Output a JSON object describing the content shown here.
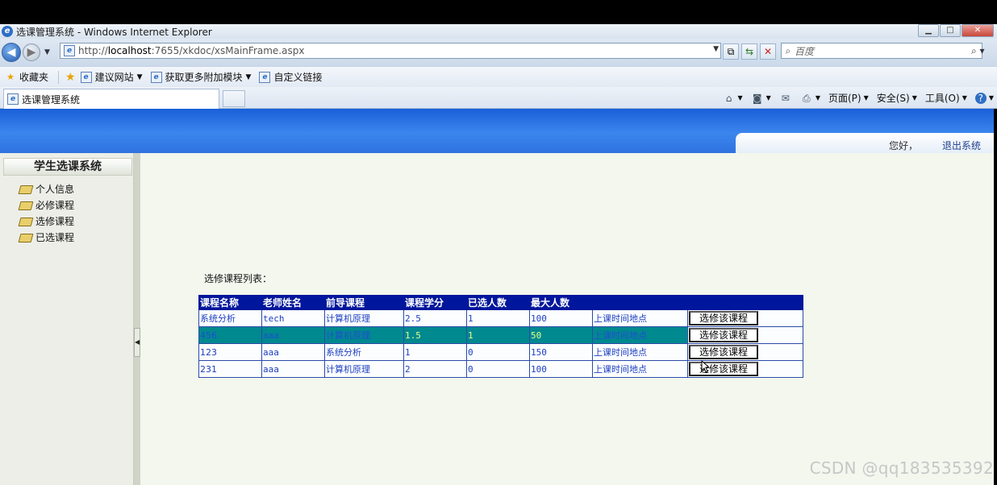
{
  "window": {
    "title": "选课管理系统 - Windows Internet Explorer",
    "minimize": "▁",
    "maximize": "□",
    "close": "✕"
  },
  "addressbar": {
    "url_prefix": "http://",
    "url_host": "localhost",
    "url_rest": ":7655/xkdoc/xsMainFrame.aspx",
    "search_placeholder": "百度"
  },
  "favorites": {
    "label": "收藏夹",
    "items": [
      "建议网站",
      "获取更多附加模块",
      "自定义链接"
    ]
  },
  "tab": {
    "title": "选课管理系统"
  },
  "commandbar": {
    "page": "页面(P)",
    "safety": "安全(S)",
    "tools": "工具(O)"
  },
  "header": {
    "greeting": "您好，",
    "logout": "退出系统"
  },
  "sidebar": {
    "title": "学生选课系统",
    "items": [
      "个人信息",
      "必修课程",
      "选修课程",
      "已选课程"
    ]
  },
  "content": {
    "list_title": "选修课程列表：",
    "columns": [
      "课程名称",
      "老师姓名",
      "前导课程",
      "课程学分",
      "已选人数",
      "最大人数",
      "",
      ""
    ],
    "rows": [
      {
        "name": "系统分析",
        "teacher": "tech",
        "prereq": "计算机原理",
        "credit": "2.5",
        "selected": "1",
        "max": "100",
        "time_link": "上课时间地点",
        "button": "选修该课程"
      },
      {
        "name": "456",
        "teacher": "aaa",
        "prereq": "计算机原理",
        "credit": "1.5",
        "selected": "1",
        "max": "50",
        "time_link": "上课时间地点",
        "button": "选修该课程"
      },
      {
        "name": "123",
        "teacher": "aaa",
        "prereq": "系统分析",
        "credit": "1",
        "selected": "0",
        "max": "150",
        "time_link": "上课时间地点",
        "button": "选修该课程"
      },
      {
        "name": "231",
        "teacher": "aaa",
        "prereq": "计算机原理",
        "credit": "2",
        "selected": "0",
        "max": "100",
        "time_link": "上课时间地点",
        "button": "选修该课程"
      }
    ],
    "highlighted_row": 1
  },
  "watermark": "CSDN @qq183535392",
  "colors": {
    "banner": "#2f72e0",
    "table_header": "#00169c",
    "row_highlight": "#00898f",
    "link": "#1d3ec0"
  }
}
